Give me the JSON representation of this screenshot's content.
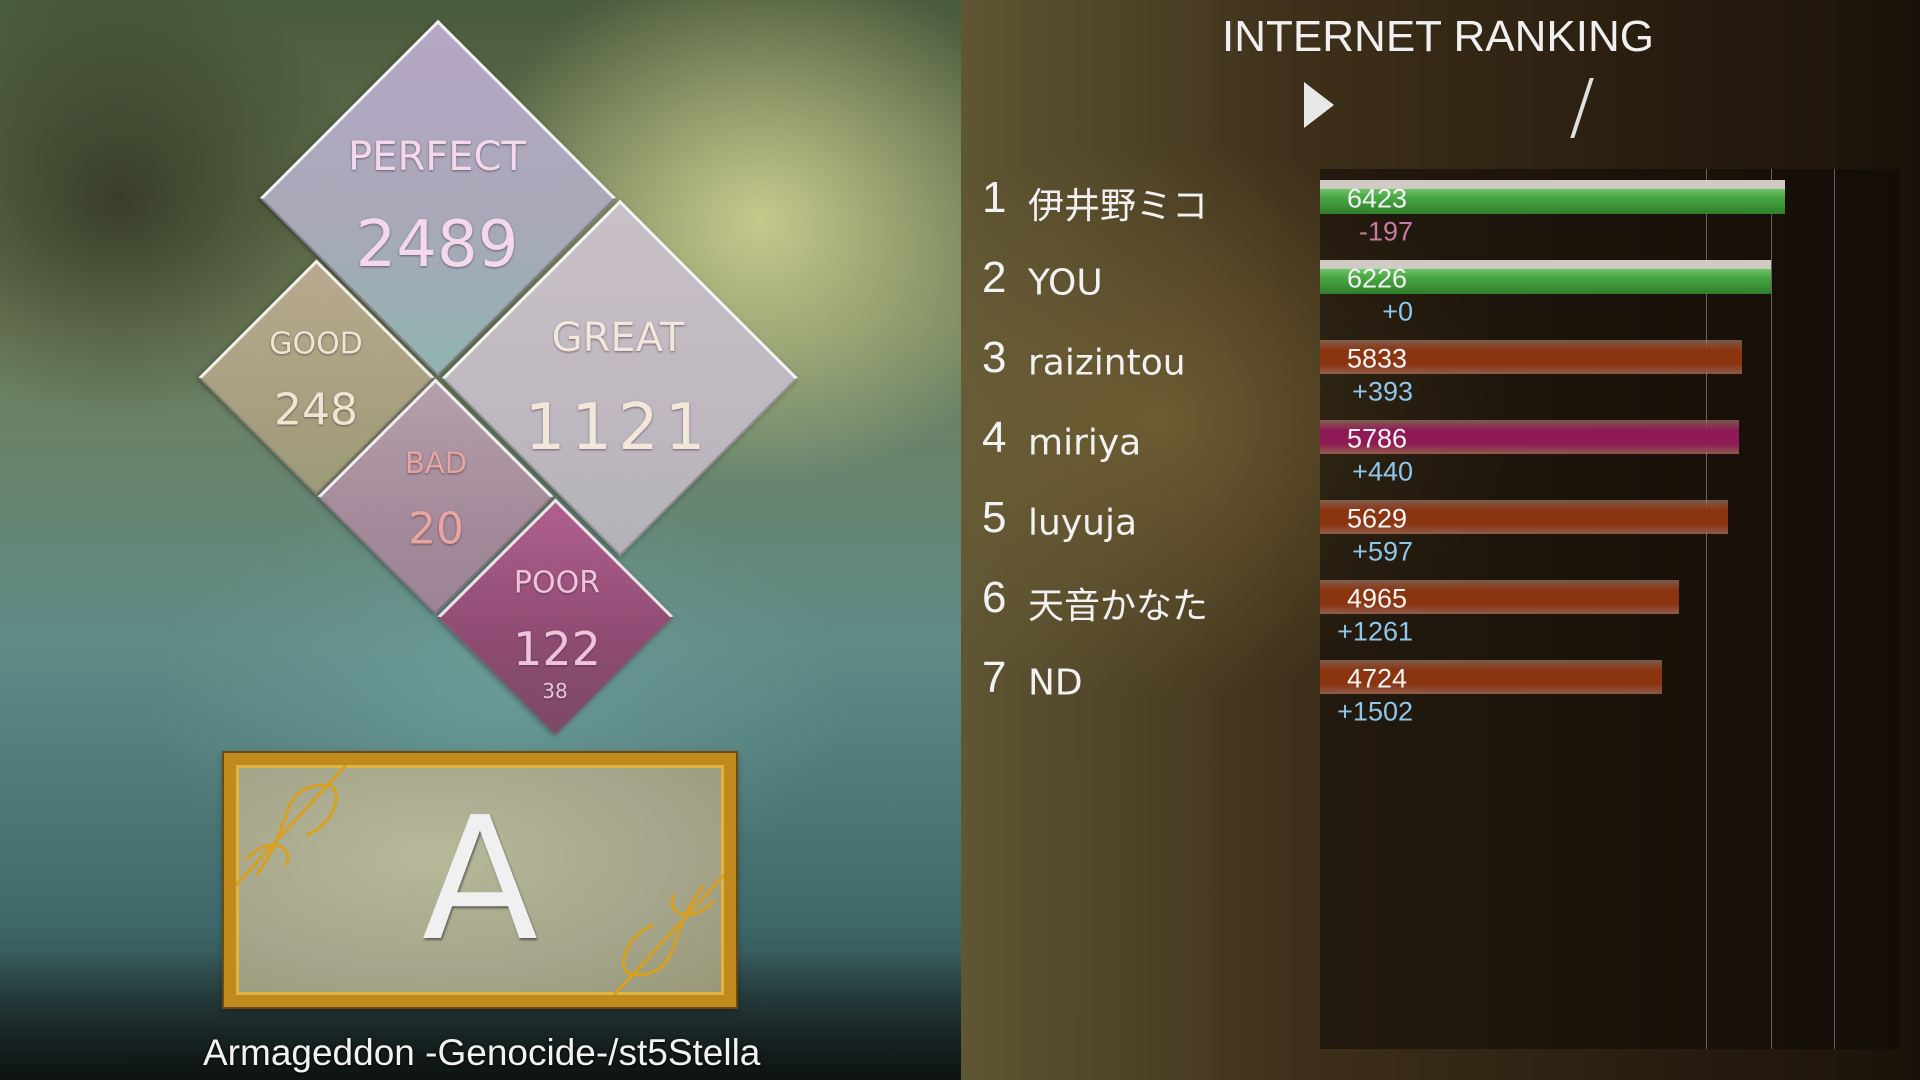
{
  "judges": {
    "perfect": {
      "label": "PERFECT",
      "count": "2489"
    },
    "great": {
      "label": "GREAT",
      "count": "1121"
    },
    "good": {
      "label": "GOOD",
      "count": "248"
    },
    "bad": {
      "label": "BAD",
      "count": "20"
    },
    "poor": {
      "label": "POOR",
      "count": "122",
      "sub": "38"
    }
  },
  "grade": "A",
  "song_title": "Armageddon -Genocide-/st5Stella",
  "ranking": {
    "title": "INTERNET RANKING",
    "play_icon": "play-triangle-icon",
    "separator": "/",
    "colors": {
      "green": "#3f9a3a",
      "orange": "#8a3410",
      "pink": "#8e1a56",
      "negative": "#c87aa2",
      "positive": "#8fc6ea"
    },
    "entries": [
      {
        "rank": "1",
        "name": "伊井野ミコ",
        "score": 6423,
        "score_text": "6423",
        "diff": "-197",
        "color": "green"
      },
      {
        "rank": "2",
        "name": "YOU",
        "score": 6226,
        "score_text": "6226",
        "diff": "+0",
        "color": "green"
      },
      {
        "rank": "3",
        "name": "raizintou",
        "score": 5833,
        "score_text": "5833",
        "diff": "+393",
        "color": "orange"
      },
      {
        "rank": "4",
        "name": "miriya",
        "score": 5786,
        "score_text": "5786",
        "diff": "+440",
        "color": "pink"
      },
      {
        "rank": "5",
        "name": "luyuja",
        "score": 5629,
        "score_text": "5629",
        "diff": "+597",
        "color": "orange"
      },
      {
        "rank": "6",
        "name": "天音かなた",
        "score": 4965,
        "score_text": "4965",
        "diff": "+1261",
        "color": "orange"
      },
      {
        "rank": "7",
        "name": "ND",
        "score": 4724,
        "score_text": "4724",
        "diff": "+1502",
        "color": "orange"
      }
    ]
  }
}
